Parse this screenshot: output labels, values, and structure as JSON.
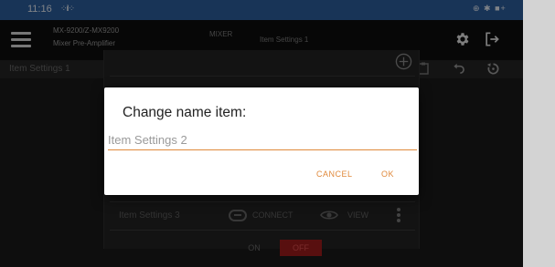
{
  "status_bar": {
    "time": "11:16",
    "network": "⁘il⁘",
    "system_icons": "⊕ ✱ ■+"
  },
  "header": {
    "device_model": "MX-9200/Z-MX9200",
    "device_desc": "Mixer Pre-Amplifier",
    "nav_mixer": "MIXER",
    "nav_current": "Item Settings 1"
  },
  "sub_bar": {
    "title": "Item Settings 1"
  },
  "list": {
    "row3": {
      "label": "Item Settings 3",
      "connect_label": "CONNECT",
      "view_label": "VIEW"
    }
  },
  "toggle": {
    "on_label": "ON",
    "off_label": "OFF"
  },
  "dialog": {
    "title": "Change name item:",
    "input_placeholder": "Item Settings 2",
    "cancel_label": "CANCEL",
    "ok_label": "OK"
  },
  "colors": {
    "status_bar": "#2d5f9e",
    "accent": "#e0893b",
    "off_red": "#a11d1d"
  },
  "icons": [
    "menu-icon",
    "gear-icon",
    "exit-icon",
    "add-circle-icon",
    "paste-icon",
    "undo-icon",
    "refresh-icon",
    "connect-link-icon",
    "eye-icon",
    "kebab-icon"
  ]
}
